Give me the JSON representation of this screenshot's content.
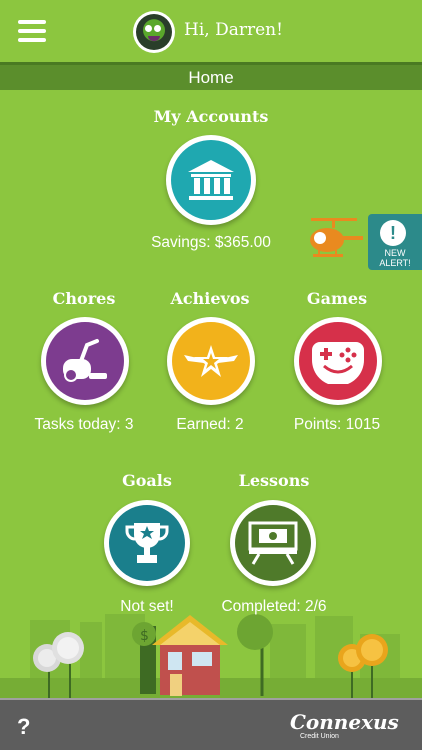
{
  "header": {
    "greeting": "Hi, Darren!",
    "menu_icon": "hamburger-menu-icon"
  },
  "nav": {
    "title": "Home"
  },
  "accounts": {
    "title": "My Accounts",
    "caption": "Savings: $365.00",
    "icon": "bank-icon",
    "color": "#1fa8b0"
  },
  "alert": {
    "badge": "!",
    "text": "NEW ALERT!"
  },
  "tiles": [
    {
      "title": "Chores",
      "caption": "Tasks today: 3",
      "icon": "vacuum-icon",
      "color": "#7d3c8f"
    },
    {
      "title": "Achievos",
      "caption": "Earned: 2",
      "icon": "star-wings-icon",
      "color": "#f2b21b"
    },
    {
      "title": "Games",
      "caption": "Points: 1015",
      "icon": "gamepad-icon",
      "color": "#d6304a"
    },
    {
      "title": "Goals",
      "caption": "Not set!",
      "icon": "trophy-icon",
      "color": "#1a7f8c"
    },
    {
      "title": "Lessons",
      "caption": "Completed: 2/6",
      "icon": "lesson-board-icon",
      "color": "#4f7a2a"
    }
  ],
  "footer": {
    "help": "?",
    "logo": "Connexus",
    "logo_sub": "Credit Union"
  }
}
